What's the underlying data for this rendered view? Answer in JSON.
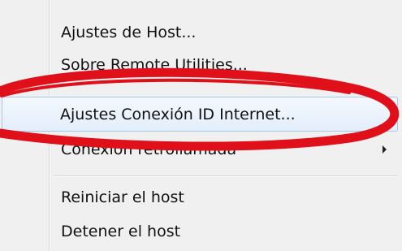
{
  "menu": {
    "items": [
      {
        "label": "Ajustes de Host..."
      },
      {
        "label": "Sobre Remote Utilities..."
      },
      {
        "label": "Ajustes Conexión ID Internet..."
      },
      {
        "label": "Conexión retrollamada"
      },
      {
        "label": "Reiniciar el host"
      },
      {
        "label": "Detener el host"
      }
    ]
  },
  "annotation": {
    "color": "#e0101a"
  }
}
